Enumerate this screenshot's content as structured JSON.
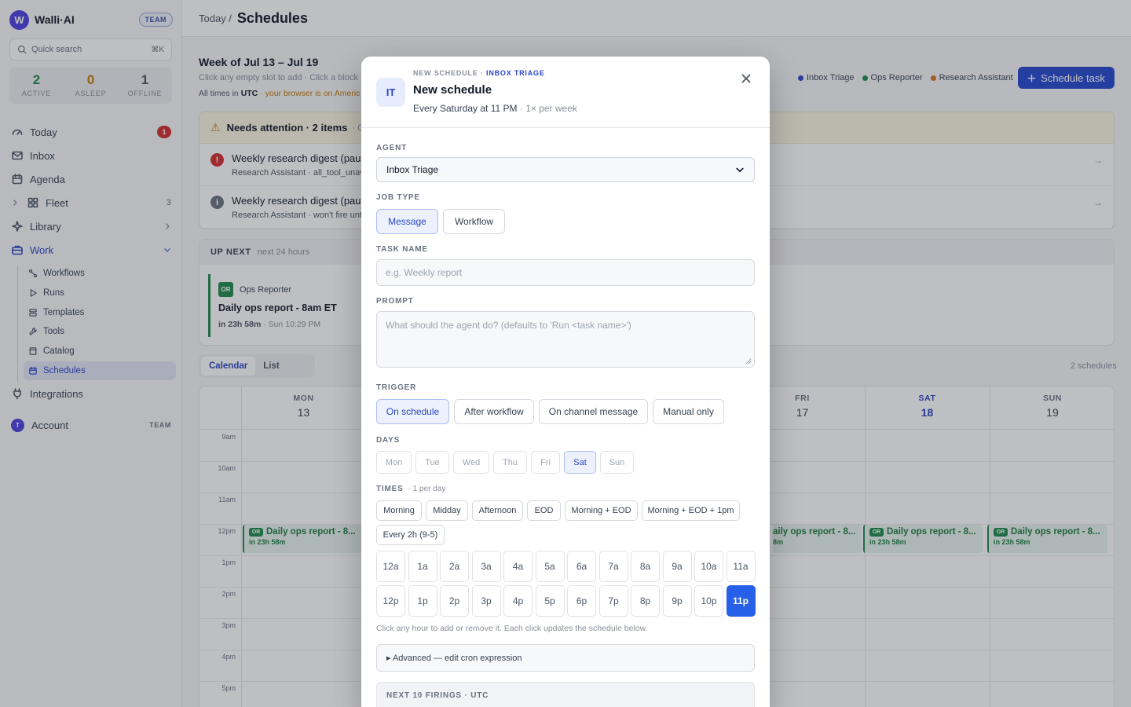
{
  "sidebar": {
    "brand": {
      "logo_letter": "W",
      "name": "Walli·AI",
      "badge": "TEAM"
    },
    "search": {
      "placeholder": "Quick search",
      "shortcut": "⌘K"
    },
    "stats": [
      {
        "value": "2",
        "label": "ACTIVE",
        "color": "#1f8a4a"
      },
      {
        "value": "0",
        "label": "ASLEEP",
        "color": "#c07a0a"
      },
      {
        "value": "1",
        "label": "OFFLINE",
        "color": "#4b5563"
      }
    ],
    "nav": {
      "today": {
        "label": "Today",
        "badge": "1"
      },
      "inbox": {
        "label": "Inbox"
      },
      "agenda": {
        "label": "Agenda"
      },
      "fleet": {
        "label": "Fleet",
        "count": "3"
      },
      "library": {
        "label": "Library"
      },
      "work": {
        "label": "Work"
      },
      "integrations": {
        "label": "Integrations"
      }
    },
    "work_items": [
      "Workflows",
      "Runs",
      "Templates",
      "Tools",
      "Catalog",
      "Schedules"
    ],
    "account": {
      "avatar": "T",
      "label": "Account",
      "badge": "TEAM"
    }
  },
  "header": {
    "breadcrumb": "Today /",
    "title": "Schedules"
  },
  "week": {
    "title": "Week of Jul 13 – Jul 19",
    "subtitle": "Click any empty slot to add · Click a block",
    "tz_prefix": "All times in",
    "tz": "UTC",
    "tz_warning": "· your browser is on Americ"
  },
  "legend": [
    {
      "name": "Inbox Triage",
      "color": "#2a46c4"
    },
    {
      "name": "Ops Reporter",
      "color": "#1f8a4a"
    },
    {
      "name": "Research Assistant",
      "color": "#d4751a"
    }
  ],
  "schedule_button": "Schedule task",
  "attention": {
    "title": "Needs attention · 2 items",
    "subtitle": "· Cl",
    "items": [
      {
        "icon": "!",
        "color": "#d12b2b",
        "title": "Weekly research digest (paus",
        "sub": "Research Assistant · all_tool_unav",
        "arrow": "→"
      },
      {
        "icon": "i",
        "color": "#6b7280",
        "title": "Weekly research digest (paus",
        "sub": "Research Assistant · won't fire unt",
        "arrow": "→"
      }
    ]
  },
  "upnext": {
    "title": "UP NEXT",
    "sub": "next 24 hours",
    "card": {
      "badge": "OR",
      "agent": "Ops Reporter",
      "title": "Daily ops report - 8am ET",
      "when": "in 23h 58m",
      "time": "· Sun 10:29 PM"
    }
  },
  "view_tabs": {
    "calendar": "Calendar",
    "list": "List"
  },
  "schedule_count": "2 schedules",
  "calendar": {
    "days": [
      {
        "name": "MON",
        "date": "13"
      },
      {
        "name": "FRI",
        "date": "17"
      },
      {
        "name": "SAT",
        "date": "18"
      },
      {
        "name": "SUN",
        "date": "19"
      }
    ],
    "hours": [
      "9am",
      "10am",
      "11am",
      "12pm",
      "1pm",
      "2pm",
      "3pm",
      "4pm",
      "5pm"
    ],
    "events": [
      {
        "badge": "OR",
        "title": "Daily ops report - 8...",
        "sub": "in 23h 58m"
      },
      {
        "title": "aily ops report - 8...",
        "sub": "8m"
      },
      {
        "badge": "OR",
        "title": "Daily ops report - 8...",
        "sub": "in 23h 58m"
      },
      {
        "badge": "OR",
        "title": "Daily ops report - 8...",
        "sub": "in 23h 58m"
      }
    ]
  },
  "modal": {
    "avatar": "IT",
    "kicker": "NEW SCHEDULE ·",
    "kicker_agent": "INBOX TRIAGE",
    "title": "New schedule",
    "summary": "Every Saturday at 11 PM",
    "summary_freq": "· 1× per week",
    "agent_label": "AGENT",
    "agent_value": "Inbox Triage",
    "job_type_label": "JOB TYPE",
    "job_types": [
      "Message",
      "Workflow"
    ],
    "task_name_label": "TASK NAME",
    "task_name_placeholder": "e.g. Weekly report",
    "prompt_label": "PROMPT",
    "prompt_placeholder": "What should the agent do? (defaults to 'Run <task name>')",
    "trigger_label": "TRIGGER",
    "triggers": [
      "On schedule",
      "After workflow",
      "On channel message",
      "Manual only"
    ],
    "days_label": "DAYS",
    "days": [
      "Mon",
      "Tue",
      "Wed",
      "Thu",
      "Fri",
      "Sat",
      "Sun"
    ],
    "selected_day": "Sat",
    "times_label": "TIMES",
    "times_note": "· 1 per day",
    "presets": [
      "Morning",
      "Midday",
      "Afternoon",
      "EOD",
      "Morning + EOD",
      "Morning + EOD + 1pm",
      "Every 2h (9-5)"
    ],
    "hours_am": [
      "12a",
      "1a",
      "2a",
      "3a",
      "4a",
      "5a",
      "6a",
      "7a",
      "8a",
      "9a",
      "10a",
      "11a"
    ],
    "hours_pm": [
      "12p",
      "1p",
      "2p",
      "3p",
      "4p",
      "5p",
      "6p",
      "7p",
      "8p",
      "9p",
      "10p",
      "11p"
    ],
    "selected_hour": "11p",
    "hint": "Click any hour to add or remove it. Each click updates the schedule below.",
    "advanced": "▸ Advanced — edit cron expression",
    "firings": "NEXT 10 FIRINGS · UTC"
  }
}
